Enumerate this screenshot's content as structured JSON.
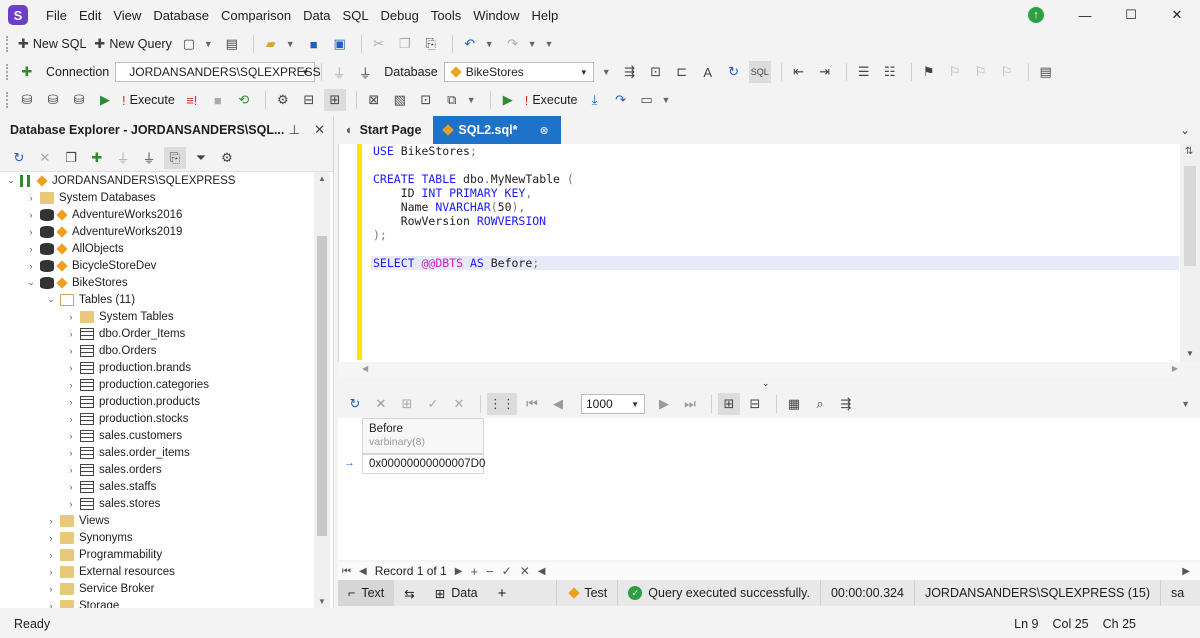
{
  "menu": [
    "File",
    "Edit",
    "View",
    "Database",
    "Comparison",
    "Data",
    "SQL",
    "Debug",
    "Tools",
    "Window",
    "Help"
  ],
  "toolbar1": {
    "new_sql": "New SQL",
    "new_query": "New Query"
  },
  "toolbar2": {
    "connection_label": "Connection",
    "connection_value": "JORDANSANDERS\\SQLEXPRESS",
    "database_label": "Database",
    "database_value": "BikeStores"
  },
  "toolbar3": {
    "execute_label": "Execute",
    "execute2_label": "Execute"
  },
  "explorer": {
    "title": "Database Explorer - JORDANSANDERS\\SQL...",
    "tree": [
      {
        "label": "JORDANSANDERS\\SQLEXPRESS",
        "level": 0,
        "icon": "server",
        "expanded": true
      },
      {
        "label": "System Databases",
        "level": 1,
        "icon": "folder",
        "expanded": false
      },
      {
        "label": "AdventureWorks2016",
        "level": 1,
        "icon": "db",
        "expanded": false
      },
      {
        "label": "AdventureWorks2019",
        "level": 1,
        "icon": "db",
        "expanded": false
      },
      {
        "label": "AllObjects",
        "level": 1,
        "icon": "db",
        "expanded": false
      },
      {
        "label": "BicycleStoreDev",
        "level": 1,
        "icon": "db",
        "expanded": false
      },
      {
        "label": "BikeStores",
        "level": 1,
        "icon": "db",
        "expanded": true
      },
      {
        "label": "Tables (11)",
        "level": 2,
        "icon": "folder-open",
        "expanded": true
      },
      {
        "label": "System Tables",
        "level": 3,
        "icon": "folder",
        "expanded": false
      },
      {
        "label": "dbo.Order_Items",
        "level": 3,
        "icon": "table",
        "expanded": false
      },
      {
        "label": "dbo.Orders",
        "level": 3,
        "icon": "table",
        "expanded": false
      },
      {
        "label": "production.brands",
        "level": 3,
        "icon": "table",
        "expanded": false
      },
      {
        "label": "production.categories",
        "level": 3,
        "icon": "table",
        "expanded": false
      },
      {
        "label": "production.products",
        "level": 3,
        "icon": "table",
        "expanded": false
      },
      {
        "label": "production.stocks",
        "level": 3,
        "icon": "table",
        "expanded": false
      },
      {
        "label": "sales.customers",
        "level": 3,
        "icon": "table",
        "expanded": false
      },
      {
        "label": "sales.order_items",
        "level": 3,
        "icon": "table",
        "expanded": false
      },
      {
        "label": "sales.orders",
        "level": 3,
        "icon": "table",
        "expanded": false
      },
      {
        "label": "sales.staffs",
        "level": 3,
        "icon": "table",
        "expanded": false
      },
      {
        "label": "sales.stores",
        "level": 3,
        "icon": "table",
        "expanded": false
      },
      {
        "label": "Views",
        "level": 2,
        "icon": "folder",
        "expanded": false
      },
      {
        "label": "Synonyms",
        "level": 2,
        "icon": "folder",
        "expanded": false
      },
      {
        "label": "Programmability",
        "level": 2,
        "icon": "folder",
        "expanded": false
      },
      {
        "label": "External resources",
        "level": 2,
        "icon": "folder",
        "expanded": false
      },
      {
        "label": "Service Broker",
        "level": 2,
        "icon": "folder",
        "expanded": false
      },
      {
        "label": "Storage",
        "level": 2,
        "icon": "folder",
        "expanded": false
      }
    ]
  },
  "tabs": {
    "start_page": "Start Page",
    "sql2": "SQL2.sql*"
  },
  "editor": {
    "lines": [
      [
        {
          "t": "USE ",
          "c": "kw"
        },
        {
          "t": "BikeStores",
          "c": ""
        },
        {
          "t": ";",
          "c": "pn"
        }
      ],
      [],
      [
        {
          "t": "CREATE TABLE ",
          "c": "kw"
        },
        {
          "t": "dbo",
          "c": ""
        },
        {
          "t": ".",
          "c": "pn"
        },
        {
          "t": "MyNewTable ",
          "c": ""
        },
        {
          "t": "(",
          "c": "pn"
        }
      ],
      [
        {
          "t": "    ID ",
          "c": ""
        },
        {
          "t": "INT PRIMARY KEY",
          "c": "kw"
        },
        {
          "t": ",",
          "c": "pn"
        }
      ],
      [
        {
          "t": "    Name ",
          "c": ""
        },
        {
          "t": "NVARCHAR",
          "c": "kw"
        },
        {
          "t": "(",
          "c": "pn"
        },
        {
          "t": "50",
          "c": ""
        },
        {
          "t": "),",
          "c": "pn"
        }
      ],
      [
        {
          "t": "    RowVersion ",
          "c": ""
        },
        {
          "t": "ROWVERSION",
          "c": "kw"
        }
      ],
      [
        {
          "t": ");",
          "c": "pn"
        }
      ],
      [],
      [
        {
          "t": "SELECT ",
          "c": "kw"
        },
        {
          "t": "@@DBTS ",
          "c": "fn"
        },
        {
          "t": "AS ",
          "c": "kw"
        },
        {
          "t": "Before",
          "c": ""
        },
        {
          "t": ";",
          "c": "pn"
        }
      ]
    ],
    "highlight_line": 8
  },
  "results": {
    "page_size": "1000",
    "column_name": "Before",
    "column_type": "varbinary(8)",
    "cell_value": "0x00000000000007D0",
    "record_nav": "Record 1 of 1"
  },
  "results_tabs": {
    "text": "Text",
    "data": "Data",
    "test": "Test",
    "query_status": "Query executed successfully.",
    "elapsed": "00:00:00.324",
    "server_info": "JORDANSANDERS\\SQLEXPRESS (15)",
    "user": "sa"
  },
  "status": {
    "ready": "Ready",
    "ln": "Ln 9",
    "col": "Col 25",
    "ch": "Ch 25"
  }
}
